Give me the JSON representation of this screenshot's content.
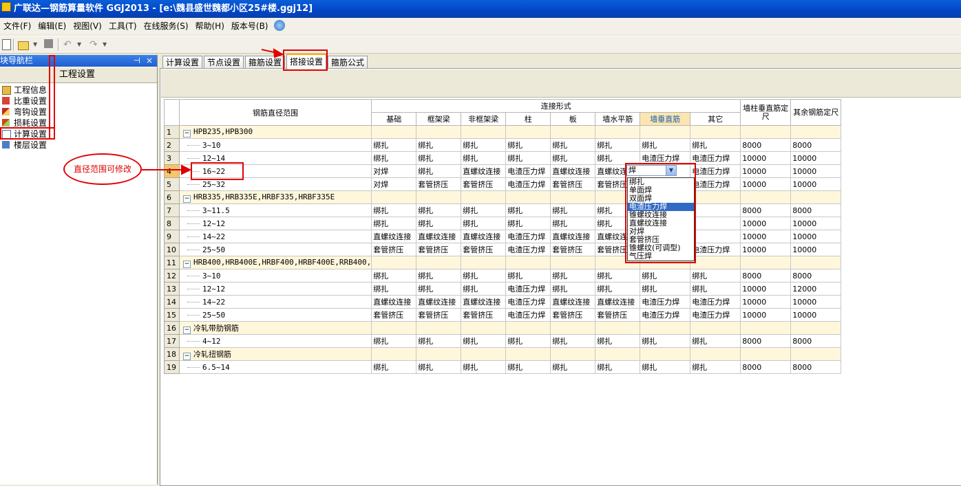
{
  "window": {
    "title": "广联达—钢筋算量软件 GGJ2013 - [e:\\魏县盛世魏都小区25#楼.ggj12]"
  },
  "menu": [
    "文件(F)",
    "编辑(E)",
    "视图(V)",
    "工具(T)",
    "在线服务(S)",
    "帮助(H)",
    "版本号(B)"
  ],
  "nav": {
    "title": "模块导航栏",
    "pin": "⊣",
    "close": "×",
    "section": "工程设置",
    "items": [
      "工程信息",
      "比重设置",
      "弯钩设置",
      "损耗设置",
      "计算设置",
      "楼层设置"
    ]
  },
  "tabs": [
    "计算设置",
    "节点设置",
    "箍筋设置",
    "搭接设置",
    "箍筋公式"
  ],
  "grid": {
    "h_range": "钢筋直径范围",
    "h_group": "连接形式",
    "h_cols": [
      "基础",
      "框架梁",
      "非框架梁",
      "柱",
      "板",
      "墙水平筋",
      "墙垂直筋",
      "其它"
    ],
    "h_wall_len": "墙柱垂直筋定尺",
    "h_other_len": "其余钢筋定尺",
    "rows": [
      {
        "n": "1",
        "label": "HPB235,HPB300",
        "group": true
      },
      {
        "n": "2",
        "label": "3~10",
        "cells": [
          "绑扎",
          "绑扎",
          "绑扎",
          "绑扎",
          "绑扎",
          "绑扎",
          "绑扎",
          "绑扎",
          "8000",
          "8000"
        ]
      },
      {
        "n": "3",
        "label": "12~14",
        "cells": [
          "绑扎",
          "绑扎",
          "绑扎",
          "绑扎",
          "绑扎",
          "绑扎",
          "电渣压力焊",
          "电渣压力焊",
          "10000",
          "10000"
        ]
      },
      {
        "n": "4",
        "label": "16~22",
        "cells": [
          "对焊",
          "绑扎",
          "直螺纹连接",
          "电渣压力焊",
          "直螺纹连接",
          "直螺纹连接",
          "",
          "电渣压力焊",
          "10000",
          "10000"
        ]
      },
      {
        "n": "5",
        "label": "25~32",
        "cells": [
          "对焊",
          "套管挤压",
          "套管挤压",
          "电渣压力焊",
          "套管挤压",
          "套管挤压",
          "",
          "电渣压力焊",
          "10000",
          "10000"
        ]
      },
      {
        "n": "6",
        "label": "HRB335,HRB335E,HRBF335,HRBF335E",
        "group": true
      },
      {
        "n": "7",
        "label": "3~11.5",
        "cells": [
          "绑扎",
          "绑扎",
          "绑扎",
          "绑扎",
          "绑扎",
          "绑扎",
          "",
          "",
          "8000",
          "8000"
        ]
      },
      {
        "n": "8",
        "label": "12~12",
        "cells": [
          "绑扎",
          "绑扎",
          "绑扎",
          "绑扎",
          "绑扎",
          "绑扎",
          "",
          "",
          "10000",
          "10000"
        ]
      },
      {
        "n": "9",
        "label": "14~22",
        "cells": [
          "直螺纹连接",
          "直螺纹连接",
          "直螺纹连接",
          "电渣压力焊",
          "直螺纹连接",
          "直螺纹连接",
          "",
          "",
          "10000",
          "10000"
        ]
      },
      {
        "n": "10",
        "label": "25~50",
        "cells": [
          "套管挤压",
          "套管挤压",
          "套管挤压",
          "电渣压力焊",
          "套管挤压",
          "套管挤压",
          "",
          "电渣压力焊",
          "10000",
          "10000"
        ]
      },
      {
        "n": "11",
        "label": "HRB400,HRB400E,HRBF400,HRBF400E,RRB400,",
        "group": true
      },
      {
        "n": "12",
        "label": "3~10",
        "cells": [
          "绑扎",
          "绑扎",
          "绑扎",
          "绑扎",
          "绑扎",
          "绑扎",
          "绑扎",
          "绑扎",
          "8000",
          "8000"
        ]
      },
      {
        "n": "13",
        "label": "12~12",
        "cells": [
          "绑扎",
          "绑扎",
          "绑扎",
          "电渣压力焊",
          "绑扎",
          "绑扎",
          "绑扎",
          "绑扎",
          "10000",
          "12000"
        ]
      },
      {
        "n": "14",
        "label": "14~22",
        "cells": [
          "直螺纹连接",
          "直螺纹连接",
          "直螺纹连接",
          "电渣压力焊",
          "直螺纹连接",
          "直螺纹连接",
          "电渣压力焊",
          "电渣压力焊",
          "10000",
          "10000"
        ]
      },
      {
        "n": "15",
        "label": "25~50",
        "cells": [
          "套管挤压",
          "套管挤压",
          "套管挤压",
          "电渣压力焊",
          "套管挤压",
          "套管挤压",
          "电渣压力焊",
          "电渣压力焊",
          "10000",
          "10000"
        ]
      },
      {
        "n": "16",
        "label": "冷轧带肋钢筋",
        "group": true
      },
      {
        "n": "17",
        "label": "4~12",
        "cells": [
          "绑扎",
          "绑扎",
          "绑扎",
          "绑扎",
          "绑扎",
          "绑扎",
          "绑扎",
          "绑扎",
          "8000",
          "8000"
        ]
      },
      {
        "n": "18",
        "label": "冷轧扭钢筋",
        "group": true
      },
      {
        "n": "19",
        "label": "6.5~14",
        "cells": [
          "绑扎",
          "绑扎",
          "绑扎",
          "绑扎",
          "绑扎",
          "绑扎",
          "绑扎",
          "绑扎",
          "8000",
          "8000"
        ]
      }
    ]
  },
  "combo": {
    "value": "焊"
  },
  "dropdown": {
    "options": [
      "绑扎",
      "单面焊",
      "双面焊",
      "电渣压力焊",
      "锥螺纹连接",
      "直螺纹连接",
      "对焊",
      "套管挤压",
      "锥螺纹(可调型)",
      "气压焊"
    ],
    "selected": "电渣压力焊"
  },
  "annotation": {
    "text": "直径范围可修改",
    "color": "#e00000"
  }
}
